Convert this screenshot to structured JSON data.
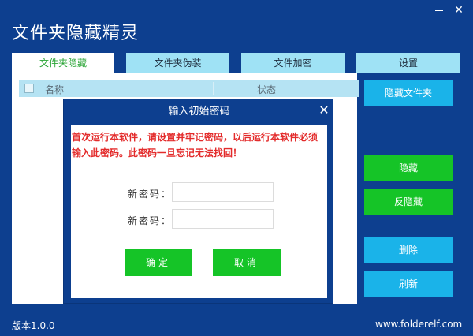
{
  "window": {
    "title": "文件夹隐藏精灵",
    "minimize_label": "—",
    "close_label": "✕"
  },
  "tabs": [
    {
      "label": "文件夹隐藏",
      "active": true
    },
    {
      "label": "文件夹伪装",
      "active": false
    },
    {
      "label": "文件加密",
      "active": false
    },
    {
      "label": "设置",
      "active": false
    }
  ],
  "list": {
    "columns": [
      "名称",
      "状态"
    ]
  },
  "side_buttons": {
    "hide_folder": "隐藏文件夹",
    "hide": "隐藏",
    "unhide": "反隐藏",
    "delete": "删除",
    "refresh": "刷新"
  },
  "dialog": {
    "title": "输入初始密码",
    "close_label": "✕",
    "warning": "首次运行本软件，请设置并牢记密码，以后运行本软件必须输入此密码。此密码一旦忘记无法找回！",
    "new_password_label": "新密码：",
    "confirm_password_label": "新密码：",
    "ok_label": "确定",
    "cancel_label": "取消"
  },
  "footer": {
    "version": "版本1.0.0",
    "website": "www.folderelf.com"
  },
  "colors": {
    "background": "#0d3f8f",
    "tab": "#9fe2f5",
    "button_cyan": "#1ab3e9",
    "button_green": "#15c427",
    "warning": "#e32b2b"
  }
}
